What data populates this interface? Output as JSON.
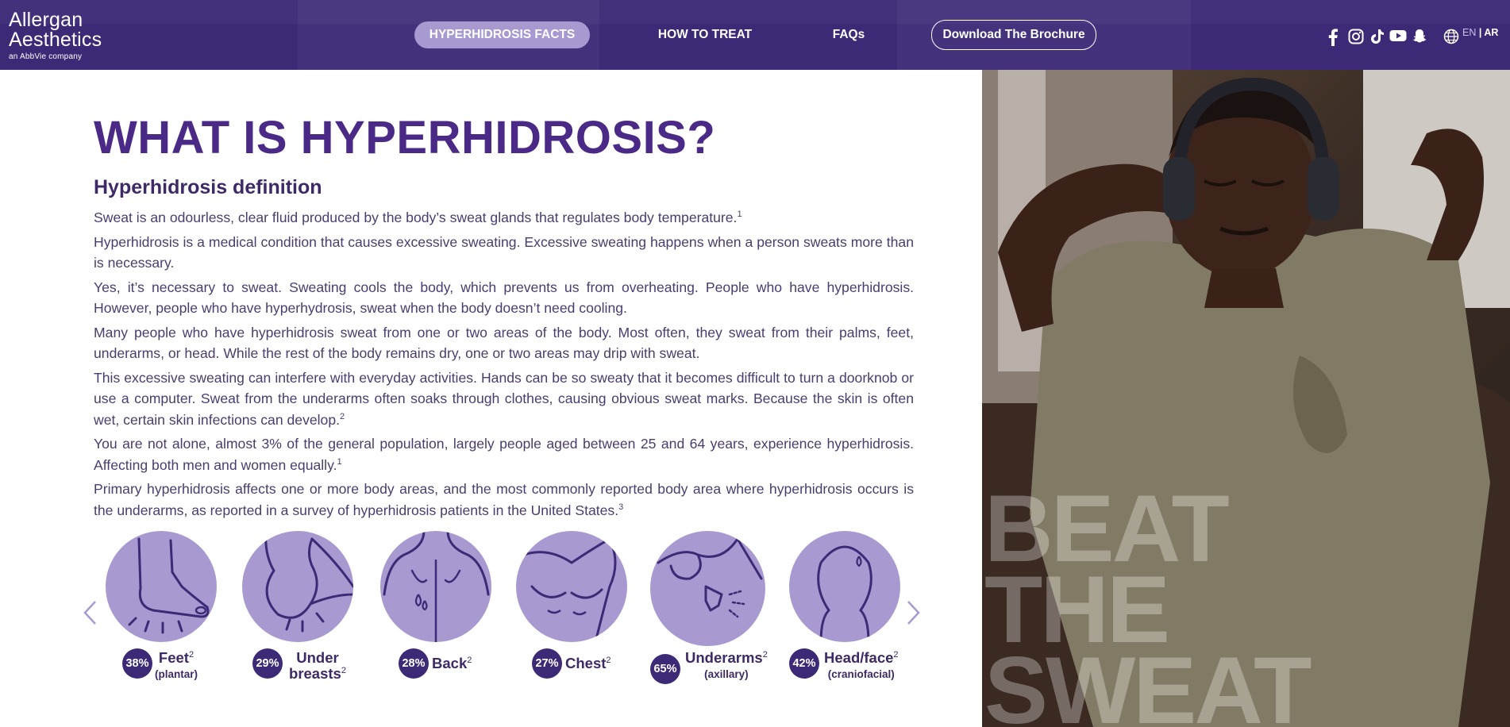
{
  "brand": {
    "line1": "Allergan",
    "line2": "Aesthetics",
    "line3": "an AbbVie company"
  },
  "nav": {
    "facts": "HYPERHIDROSIS FACTS",
    "treat": "HOW TO TREAT",
    "faqs": "FAQs",
    "brochure": "Download The Brochure"
  },
  "social_icons": [
    "facebook-icon",
    "instagram-icon",
    "tiktok-icon",
    "youtube-icon",
    "snapchat-icon"
  ],
  "language": {
    "en": "EN",
    "separator": " | ",
    "ar": "AR"
  },
  "main": {
    "title": "WHAT IS HYPERHIDROSIS?",
    "subtitle": "Hyperhidrosis definition",
    "paragraphs": [
      {
        "text": "Sweat is an odourless, clear fluid produced by the body’s sweat glands that regulates body temperature.",
        "ref": "1"
      },
      {
        "text": "Hyperhidrosis is a medical condition that causes excessive sweating. Excessive sweating happens when a person sweats more than is necessary.",
        "ref": ""
      },
      {
        "text": "Yes, it’s necessary to sweat. Sweating cools the body, which prevents us from overheating. People who have hyperhidrosis. However, people who have hyperhydrosis, sweat when the body doesn’t need cooling.",
        "ref": ""
      },
      {
        "text": "Many people who have hyperhidrosis sweat from one or two areas of the body. Most often, they sweat from their palms, feet, underarms, or head. While the rest of the body remains dry, one or two areas may drip with sweat.",
        "ref": ""
      },
      {
        "text": "This excessive sweating can interfere with everyday activities. Hands can be so sweaty that it becomes difficult to turn a doorknob or use a computer. Sweat from the underarms often soaks through clothes, causing obvious sweat marks. Because the skin is often wet, certain skin infections can develop.",
        "ref": "2"
      },
      {
        "text": "You are not alone, almost 3% of the general population, largely people aged between 25 and 64 years, experience hyperhidrosis. Affecting both men and women equally.",
        "ref": "1"
      },
      {
        "text": "Primary hyperhidrosis affects one or more body areas, and the most commonly reported body area where hyperhidrosis occurs is the underarms, as reported in a survey of hyperhidrosis patients in the United States.",
        "ref": "3"
      }
    ]
  },
  "areas": [
    {
      "percent": "38%",
      "label": "Feet",
      "ref": "2",
      "sub": "(plantar)",
      "icon": "foot-icon"
    },
    {
      "percent": "29%",
      "label": "Under breasts",
      "ref": "2",
      "sub": "",
      "icon": "under-breasts-icon"
    },
    {
      "percent": "28%",
      "label": "Back",
      "ref": "2",
      "sub": "",
      "icon": "back-icon"
    },
    {
      "percent": "27%",
      "label": "Chest",
      "ref": "2",
      "sub": "",
      "icon": "chest-icon"
    },
    {
      "percent": "65%",
      "label": "Underarms",
      "ref": "2",
      "sub": "(axillary)",
      "icon": "underarm-icon"
    },
    {
      "percent": "42%",
      "label": "Head/face",
      "ref": "2",
      "sub": "(craniofacial)",
      "icon": "head-icon"
    }
  ],
  "hero": {
    "words": [
      "BEAT",
      "THE",
      "SWEAT"
    ]
  },
  "colors": {
    "header_bg": "#3d2a77",
    "nav_active_bg": "#a89ad0",
    "title": "#4a2a86",
    "circle": "#a89ad0",
    "badge": "#3d2a77"
  }
}
